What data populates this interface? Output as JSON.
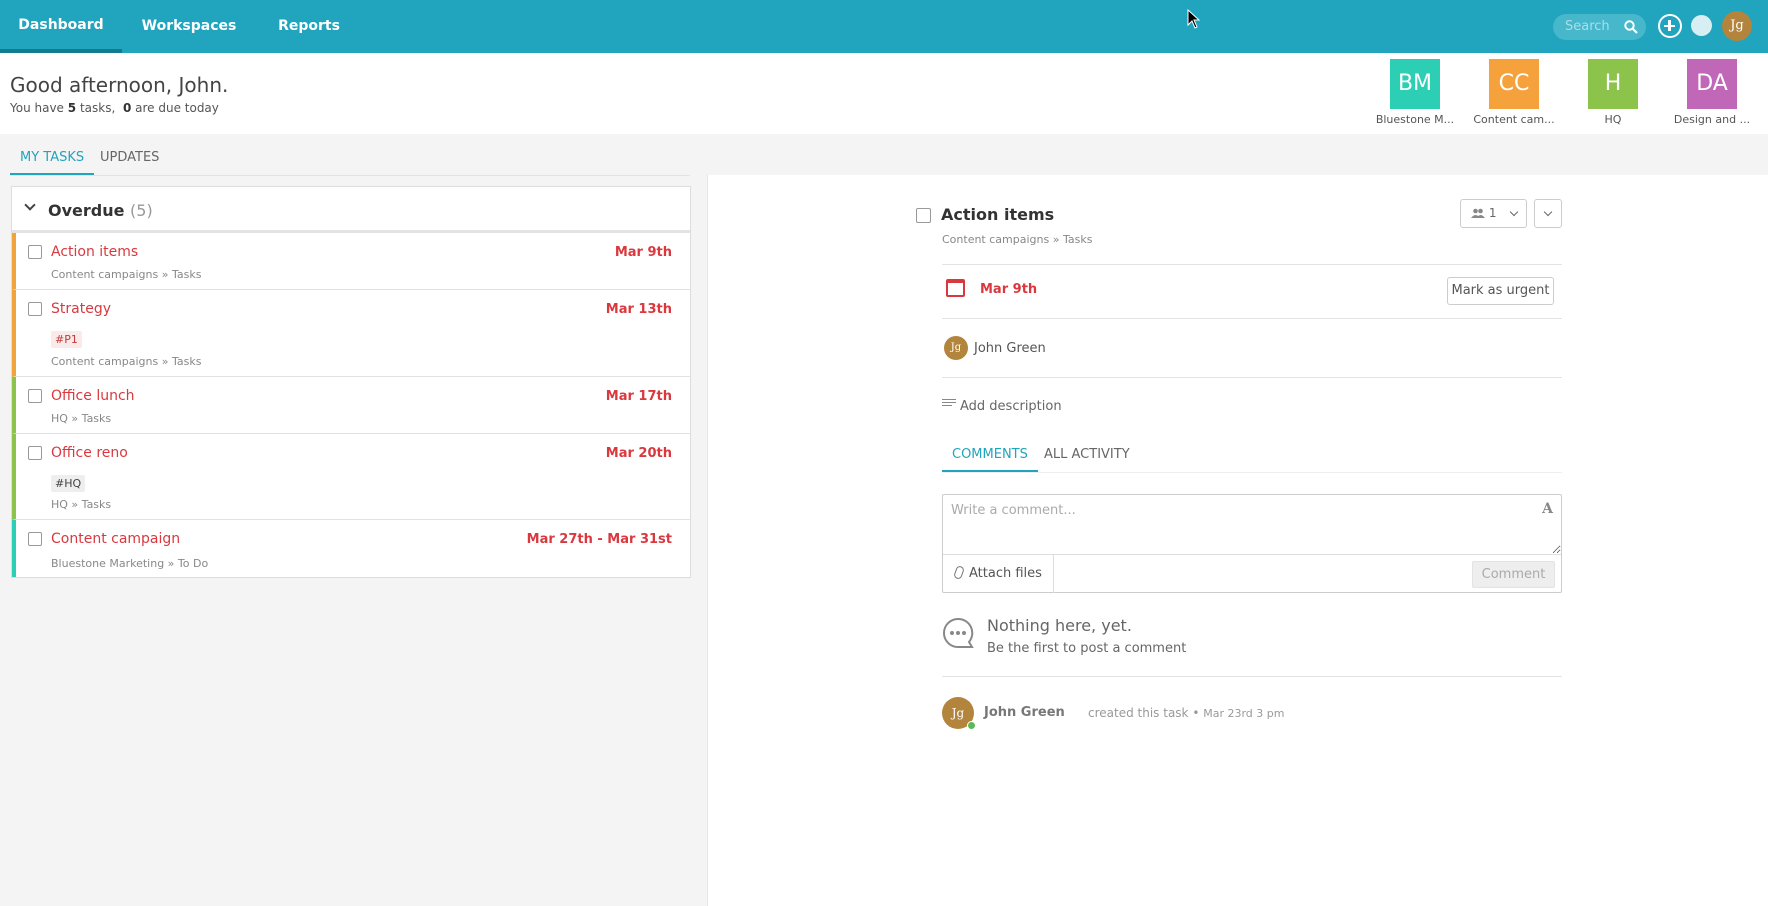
{
  "nav": {
    "tabs": [
      {
        "label": "Dashboard"
      },
      {
        "label": "Workspaces"
      },
      {
        "label": "Reports"
      }
    ],
    "search_placeholder": "Search",
    "user_initials": "Jg"
  },
  "header": {
    "greeting": "Good afternoon, John.",
    "summary_prefix": "You have",
    "task_count": "5",
    "summary_mid": "tasks,",
    "due_today": "0",
    "summary_suffix": "are due today"
  },
  "workspaces": [
    {
      "initials": "BM",
      "name": "Bluestone M...",
      "color": "#2ccfb4"
    },
    {
      "initials": "CC",
      "name": "Content cam...",
      "color": "#f6a23c"
    },
    {
      "initials": "H",
      "name": "HQ",
      "color": "#8cc34b"
    },
    {
      "initials": "DA",
      "name": "Design and ...",
      "color": "#c067b8"
    }
  ],
  "tabs": {
    "my_tasks": "MY TASKS",
    "updates": "UPDATES"
  },
  "overdue": {
    "title": "Overdue",
    "count": "(5)",
    "tasks": [
      {
        "name": "Action items",
        "date": "Mar 9th",
        "tag": "",
        "workspace": "Content campaigns",
        "list": "Tasks",
        "color": "#f2a43c"
      },
      {
        "name": "Strategy",
        "date": "Mar 13th",
        "tag": "#P1",
        "workspace": "Content campaigns",
        "list": "Tasks",
        "color": "#f2a43c"
      },
      {
        "name": "Office lunch",
        "date": "Mar 17th",
        "tag": "",
        "workspace": "HQ",
        "list": "Tasks",
        "color": "#8cc34b"
      },
      {
        "name": "Office reno",
        "date": "Mar 20th",
        "tag": "#HQ",
        "workspace": "HQ",
        "list": "Tasks",
        "color": "#8cc34b"
      },
      {
        "name": "Content campaign",
        "date": "Mar 27th - Mar 31st",
        "tag": "",
        "workspace": "Bluestone Marketing",
        "list": "To Do",
        "color": "#2ccfb4"
      }
    ]
  },
  "detail": {
    "title": "Action items",
    "workspace": "Content campaigns",
    "list": "Tasks",
    "members_count": "1",
    "due_date": "Mar 9th",
    "urgent_label": "Mark as urgent",
    "assignee": "John Green",
    "assignee_initials": "Jg",
    "add_description": "Add description",
    "comment_tabs": {
      "comments": "COMMENTS",
      "all_activity": "ALL ACTIVITY"
    },
    "comment_placeholder": "Write a comment...",
    "attach_label": "Attach files",
    "comment_button": "Comment",
    "empty_title": "Nothing here, yet.",
    "empty_sub": "Be the first to post a comment",
    "activity": {
      "user": "John Green",
      "action": "created this task",
      "time": "Mar 23rd 3 pm"
    }
  }
}
